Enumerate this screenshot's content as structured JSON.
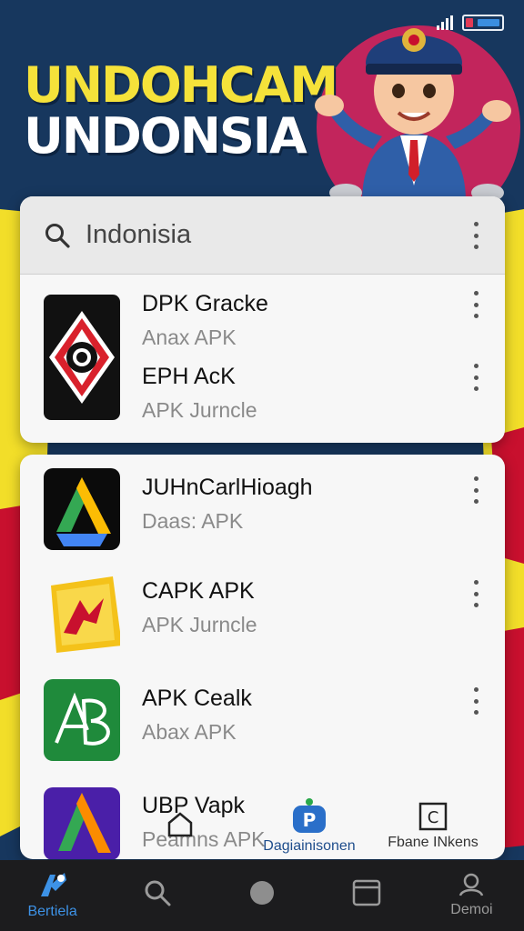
{
  "status_bar": {
    "signal_icon": "signal-bars-icon",
    "battery_icon": "battery-icon",
    "battery_color": "#e23b56"
  },
  "hero": {
    "title_line1": "UNDOHCAM",
    "title_line2": "UNDONSIA",
    "mascot": "cartoon-officer-mascot"
  },
  "search": {
    "value": "Indonisia",
    "icon": "search-icon",
    "menu_icon": "more-vert-icon"
  },
  "card1": {
    "items": [
      {
        "title": "DPK Gracke",
        "subtitle": "Anax APK",
        "icon": "red-emblem-icon"
      },
      {
        "title": "EPH AcK",
        "subtitle": "APK  Jurncle"
      }
    ]
  },
  "card2": {
    "items": [
      {
        "title": "JUHnCarlHioagh",
        "subtitle": "Daas: APK",
        "icon": "triangle-drive-icon"
      },
      {
        "title": "CAPK APK",
        "subtitle": "APK  Jurncle",
        "icon": "yellow-ak-icon"
      },
      {
        "title": "APK Cealk",
        "subtitle": "Abax APK",
        "icon": "green-ab-icon"
      },
      {
        "title": "UBP Vapk",
        "subtitle": "Peamns APK",
        "icon": "purple-triangle-icon"
      }
    ],
    "mini_tabs": [
      {
        "label": "",
        "icon": "home-outline-icon"
      },
      {
        "label": "Dagiainisonen",
        "icon": "p-badge-icon"
      },
      {
        "label": "Fbane INkens",
        "icon": "c-box-icon"
      }
    ]
  },
  "bottom_nav": [
    {
      "label": "Bertiela",
      "icon": "app-logo-icon",
      "active": true
    },
    {
      "label": "",
      "icon": "search-icon"
    },
    {
      "label": "",
      "icon": "circle-icon"
    },
    {
      "label": "",
      "icon": "window-icon"
    },
    {
      "label": "Demoi",
      "icon": "profile-icon"
    }
  ],
  "colors": {
    "background_navy": "#17375e",
    "accent_yellow": "#f5e23a",
    "accent_red": "#c8102e",
    "accent_magenta": "#c2255c",
    "nav_active": "#3d92e6"
  }
}
